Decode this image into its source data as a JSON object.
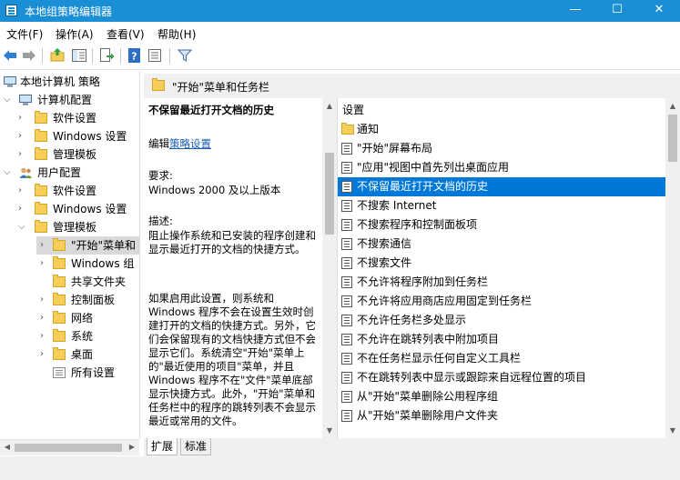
{
  "window": {
    "title": "本地组策略编辑器",
    "minimize": "—",
    "maximize": "☐",
    "close": "✕"
  },
  "menu": [
    "文件(F)",
    "操作(A)",
    "查看(V)",
    "帮助(H)"
  ],
  "tree": {
    "root": "本地计算机 策略",
    "computer": "计算机配置",
    "computer_children": [
      "软件设置",
      "Windows 设置",
      "管理模板"
    ],
    "user": "用户配置",
    "user_children": [
      "软件设置",
      "Windows 设置",
      "管理模板"
    ],
    "admin_children": [
      "\"开始\"菜单和",
      "Windows 组",
      "共享文件夹",
      "控制面板",
      "网络",
      "系统",
      "桌面",
      "所有设置"
    ]
  },
  "panel": {
    "header": "\"开始\"菜单和任务栏"
  },
  "description": {
    "policy_title": "不保留最近打开文档的历史",
    "edit_prefix": "编辑",
    "edit_link": "策略设置",
    "req_label": "要求:",
    "req_value": "Windows 2000 及以上版本",
    "desc_label": "描述:",
    "desc_text": "阻止操作系统和已安装的程序创建和显示最近打开的文档的快捷方式。",
    "detail_text": "如果启用此设置，则系统和 Windows 程序不会在设置生效时创建打开的文档的快捷方式。另外，它们会保留现有的文档快捷方式但不会显示它们。系统清空\"开始\"菜单上的\"最近使用的项目\"菜单，并且 Windows 程序不在\"文件\"菜单底部显示快捷方式。此外，\"开始\"菜单和任务栏中的程序的跳转列表不会显示最近或常用的文件。"
  },
  "list": {
    "column": "设置",
    "items": [
      "通知",
      "\"开始\"屏幕布局",
      "\"应用\"视图中首先列出桌面应用",
      "不保留最近打开文档的历史",
      "不搜索 Internet",
      "不搜索程序和控制面板项",
      "不搜索通信",
      "不搜索文件",
      "不允许将程序附加到任务栏",
      "不允许将应用商店应用固定到任务栏",
      "不允许任务栏多处显示",
      "不允许在跳转列表中附加项目",
      "不在任务栏显示任何自定义工具栏",
      "不在跳转列表中显示或跟踪来自远程位置的项目",
      "从\"开始\"菜单删除公用程序组",
      "从\"开始\"菜单删除用户文件夹"
    ],
    "selected_index": 3
  },
  "tabs": [
    "扩展",
    "标准"
  ],
  "colors": {
    "titlebar": "#1b8fd6",
    "selection": "#0078d7",
    "folder": "#f5cd59"
  }
}
